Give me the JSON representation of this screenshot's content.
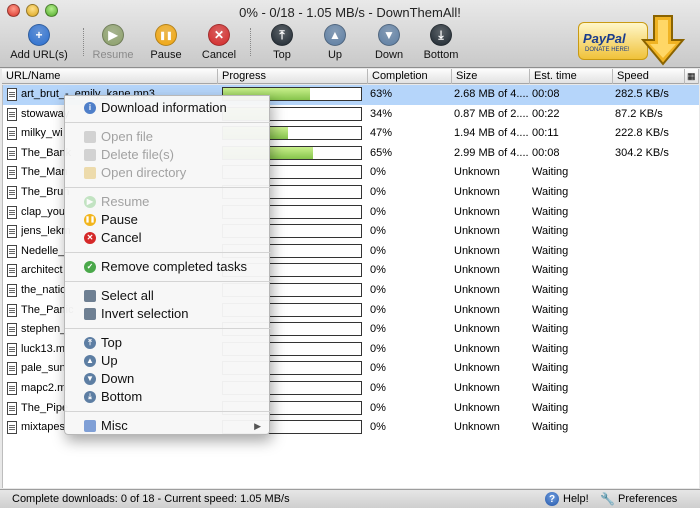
{
  "window": {
    "title": "0% - 0/18 - 1.05 MB/s - DownThemAll!"
  },
  "toolbar": {
    "buttons": [
      {
        "label": "Add URL(s)",
        "icon": "plus-icon",
        "color": "#2a6fd1",
        "enabled": true
      },
      {
        "label": "Resume",
        "icon": "play-icon",
        "color": "#8ca06a",
        "enabled": false
      },
      {
        "label": "Pause",
        "icon": "pause-icon",
        "color": "#f2a60c",
        "enabled": true
      },
      {
        "label": "Cancel",
        "icon": "x-icon",
        "color": "#d52828",
        "enabled": true
      },
      {
        "label": "Top",
        "icon": "top-icon",
        "color": "#1d2730",
        "enabled": true
      },
      {
        "label": "Up",
        "icon": "up-icon",
        "color": "#5d7ea3",
        "enabled": true
      },
      {
        "label": "Down",
        "icon": "down-icon",
        "color": "#5d7ea3",
        "enabled": true
      },
      {
        "label": "Bottom",
        "icon": "bottom-icon",
        "color": "#1d2730",
        "enabled": true
      }
    ],
    "paypal": {
      "name": "PayPal",
      "sub": "DONATE HERE!"
    }
  },
  "table": {
    "columns": [
      "URL/Name",
      "Progress",
      "Completion",
      "Size",
      "Est. time",
      "Speed"
    ],
    "rows": [
      {
        "name": "art_brut_-_emily_kane.mp3",
        "progress": 0.63,
        "completion": "63%",
        "size": "2.68 MB of 4....",
        "time": "00:08",
        "speed": "282.5 KB/s",
        "selected": true
      },
      {
        "name": "stowaway",
        "progress": 0.34,
        "completion": "34%",
        "size": "0.87 MB of 2....",
        "time": "00:22",
        "speed": "87.2 KB/s",
        "selected": false
      },
      {
        "name": "milky_wi",
        "progress": 0.47,
        "completion": "47%",
        "size": "1.94 MB of 4....",
        "time": "00:11",
        "speed": "222.8 KB/s",
        "selected": false
      },
      {
        "name": "The_Bank",
        "progress": 0.65,
        "completion": "65%",
        "size": "2.99 MB of 4....",
        "time": "00:08",
        "speed": "304.2 KB/s",
        "selected": false
      },
      {
        "name": "The_Man",
        "progress": 0,
        "completion": "0%",
        "size": "Unknown",
        "time": "Waiting",
        "speed": "",
        "selected": false
      },
      {
        "name": "The_Brun",
        "progress": 0,
        "completion": "0%",
        "size": "Unknown",
        "time": "Waiting",
        "speed": "",
        "selected": false
      },
      {
        "name": "clap_you",
        "progress": 0,
        "completion": "0%",
        "size": "Unknown",
        "time": "Waiting",
        "speed": "",
        "selected": false
      },
      {
        "name": "jens_lekm",
        "progress": 0,
        "completion": "0%",
        "size": "Unknown",
        "time": "Waiting",
        "speed": "",
        "selected": false
      },
      {
        "name": "Nedelle_",
        "progress": 0,
        "completion": "0%",
        "size": "Unknown",
        "time": "Waiting",
        "speed": "",
        "selected": false
      },
      {
        "name": "architect",
        "progress": 0,
        "completion": "0%",
        "size": "Unknown",
        "time": "Waiting",
        "speed": "",
        "selected": false
      },
      {
        "name": "the_natio",
        "progress": 0,
        "completion": "0%",
        "size": "Unknown",
        "time": "Waiting",
        "speed": "",
        "selected": false
      },
      {
        "name": "The_Panic",
        "progress": 0,
        "completion": "0%",
        "size": "Unknown",
        "time": "Waiting",
        "speed": "",
        "selected": false
      },
      {
        "name": "stephen_",
        "progress": 0,
        "completion": "0%",
        "size": "Unknown",
        "time": "Waiting",
        "speed": "",
        "selected": false
      },
      {
        "name": "luck13.m",
        "progress": 0,
        "completion": "0%",
        "size": "Unknown",
        "time": "Waiting",
        "speed": "",
        "selected": false
      },
      {
        "name": "pale_sun",
        "progress": 0,
        "completion": "0%",
        "size": "Unknown",
        "time": "Waiting",
        "speed": "",
        "selected": false
      },
      {
        "name": "mapc2.m",
        "progress": 0,
        "completion": "0%",
        "size": "Unknown",
        "time": "Waiting",
        "speed": "",
        "selected": false
      },
      {
        "name": "The_Pipe",
        "progress": 0,
        "completion": "0%",
        "size": "Unknown",
        "time": "Waiting",
        "speed": "",
        "selected": false
      },
      {
        "name": "mixtapes",
        "progress": 0,
        "completion": "0%",
        "size": "Unknown",
        "time": "Waiting",
        "speed": "",
        "selected": false
      }
    ]
  },
  "context_menu": {
    "items": [
      {
        "label": "Download information",
        "icon": "info-icon",
        "color": "#4f7fc9",
        "enabled": true
      },
      {
        "sep": true
      },
      {
        "label": "Open file",
        "icon": "file-icon",
        "color": "#b9b9b9",
        "enabled": false
      },
      {
        "label": "Delete file(s)",
        "icon": "delete-file-icon",
        "color": "#b9b9b9",
        "enabled": false
      },
      {
        "label": "Open directory",
        "icon": "folder-icon",
        "color": "#e6c87a",
        "enabled": false
      },
      {
        "sep": true
      },
      {
        "label": "Resume",
        "icon": "play-icon",
        "color": "#3bb03b",
        "enabled": false
      },
      {
        "label": "Pause",
        "icon": "pause-icon",
        "color": "#f2b51c",
        "enabled": true
      },
      {
        "label": "Cancel",
        "icon": "x-icon",
        "color": "#d52828",
        "enabled": true
      },
      {
        "sep": true
      },
      {
        "label": "Remove completed tasks",
        "icon": "check-icon",
        "color": "#4aa84a",
        "enabled": true
      },
      {
        "sep": true
      },
      {
        "label": "Select all",
        "icon": "select-all-icon",
        "color": "#6e7f92",
        "enabled": true
      },
      {
        "label": "Invert selection",
        "icon": "invert-selection-icon",
        "color": "#6e7f92",
        "enabled": true
      },
      {
        "sep": true
      },
      {
        "label": "Top",
        "icon": "top-icon",
        "color": "#5d7ea3",
        "enabled": true
      },
      {
        "label": "Up",
        "icon": "up-icon",
        "color": "#5d7ea3",
        "enabled": true
      },
      {
        "label": "Down",
        "icon": "down-icon",
        "color": "#5d7ea3",
        "enabled": true
      },
      {
        "label": "Bottom",
        "icon": "bottom-icon",
        "color": "#5d7ea3",
        "enabled": true
      },
      {
        "sep": true
      },
      {
        "label": "Misc",
        "icon": "misc-icon",
        "color": "#7f9fd6",
        "enabled": true,
        "submenu": true
      }
    ]
  },
  "statusbar": {
    "text": "Complete downloads: 0 of 18 - Current speed: 1.05 MB/s",
    "help": "Help!",
    "preferences": "Preferences"
  }
}
